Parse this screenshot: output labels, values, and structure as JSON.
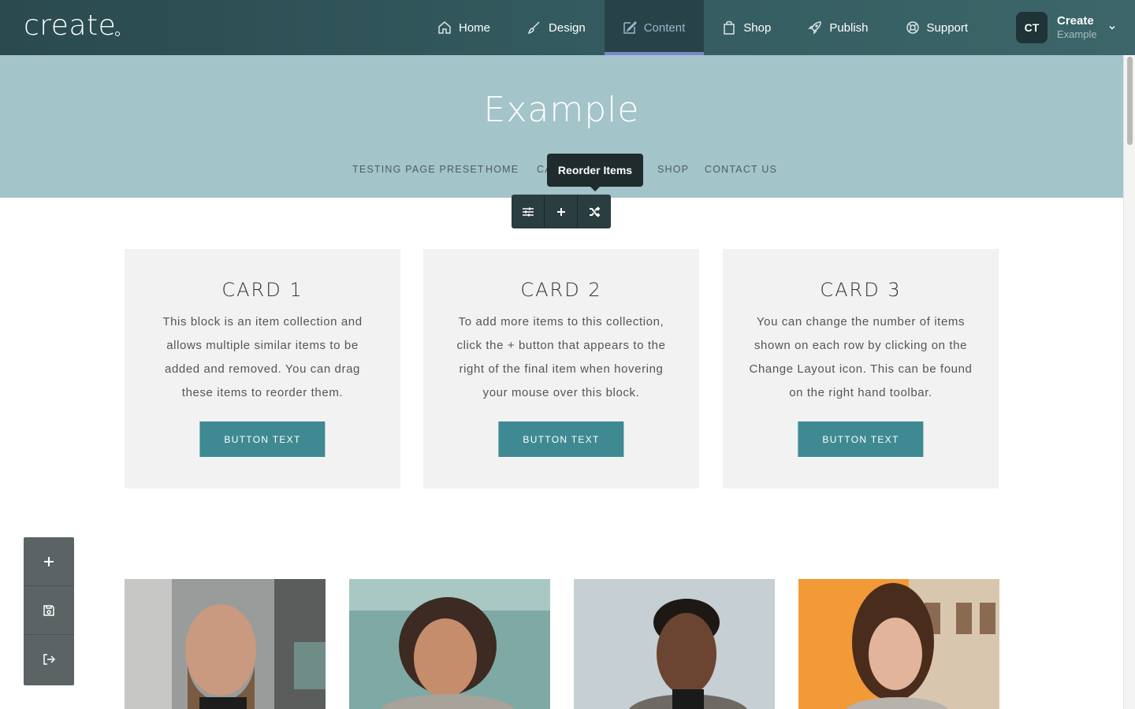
{
  "app": {
    "logo": "create"
  },
  "topnav": {
    "items": [
      {
        "label": "Home",
        "icon": "home-icon"
      },
      {
        "label": "Design",
        "icon": "brush-icon"
      },
      {
        "label": "Content",
        "icon": "edit-icon",
        "active": true
      },
      {
        "label": "Shop",
        "icon": "bag-icon"
      },
      {
        "label": "Publish",
        "icon": "rocket-icon"
      },
      {
        "label": "Support",
        "icon": "lifebuoy-icon"
      }
    ]
  },
  "account": {
    "initials": "CT",
    "name": "Create",
    "site": "Example"
  },
  "site": {
    "title": "Example",
    "nav": [
      "TESTING PAGE PRESET",
      "HOME",
      "CA",
      "SHOP",
      "CONTACT US"
    ]
  },
  "tooltip": "Reorder Items",
  "block_toolbar": [
    "settings-sliders-icon",
    "add-icon",
    "shuffle-icon"
  ],
  "cards": [
    {
      "title": "CARD 1",
      "text": "This block is an item collection and allows multiple similar items to be added and removed. You can drag these items to reorder them.",
      "button": "BUTTON TEXT"
    },
    {
      "title": "CARD 2",
      "text": "To add more items to this collection, click the + button that appears to the right of the final item when hovering your mouse over this block.",
      "button": "BUTTON TEXT"
    },
    {
      "title": "CARD 3",
      "text": "You can change the number of items shown on each row by clicking on the Change Layout icon. This can be found on the right hand toolbar.",
      "button": "BUTTON TEXT"
    }
  ],
  "side_tools": [
    "add-icon",
    "save-icon",
    "exit-icon"
  ],
  "colors": {
    "topbar": "#2f5155",
    "header": "#a3c4c9",
    "accent": "#3f8a92",
    "active_underline": "#7b86c9"
  }
}
